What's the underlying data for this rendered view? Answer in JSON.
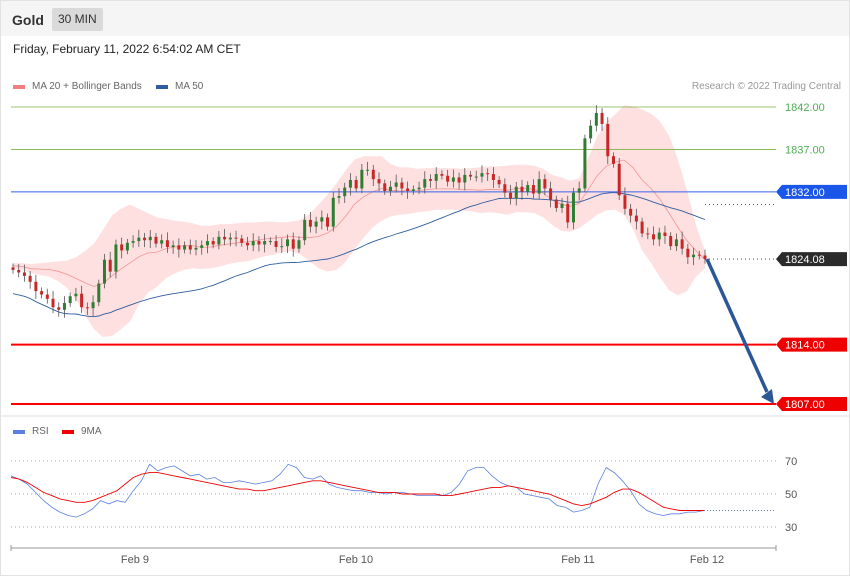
{
  "header": {
    "symbol": "Gold",
    "timeframe": "30 MIN"
  },
  "timestamp": "Friday, February 11, 2022 6:54:02 AM CET",
  "legend": {
    "ma20": {
      "label": "MA 20 + Bollinger Bands",
      "color": "#f08080"
    },
    "ma50": {
      "label": "MA 50",
      "color": "#2f5da0"
    },
    "rsi": {
      "label": "RSI",
      "color": "#5b7fe0"
    },
    "rsi_ma": {
      "label": "9MA",
      "color": "#ee0000"
    }
  },
  "credit": "Research © 2022 Trading Central",
  "colors": {
    "up": "#2e7d32",
    "down": "#c62828",
    "band": "#ffd6d6",
    "blue_line": "#3563e8",
    "red_line": "#ff0000",
    "green_line": "#7cb342",
    "arrow": "#2b5797"
  },
  "chart_data": [
    {
      "type": "candlestick",
      "ylim": [
        1801,
        1845
      ],
      "x_ticks": [
        "Feb 9",
        "Feb 10",
        "Feb 11",
        "Feb 12"
      ],
      "levels": [
        {
          "label": "1842.00",
          "value": 1842.0,
          "kind": "target"
        },
        {
          "label": "1837.00",
          "value": 1837.0,
          "kind": "target"
        },
        {
          "label": "1832.00",
          "value": 1832.0,
          "kind": "pivot"
        },
        {
          "label": "1824.08",
          "value": 1824.08,
          "kind": "last"
        },
        {
          "label": "1814.00",
          "value": 1814.0,
          "kind": "support"
        },
        {
          "label": "1807.00",
          "value": 1807.0,
          "kind": "support"
        }
      ],
      "close": [
        1822.8,
        1822.5,
        1822.1,
        1821.4,
        1820.3,
        1819.9,
        1819.4,
        1818.4,
        1818.1,
        1818.9,
        1819.7,
        1820.0,
        1818.4,
        1818.3,
        1819.0,
        1821.2,
        1824.0,
        1822.6,
        1825.8,
        1825.1,
        1826.0,
        1826.2,
        1826.6,
        1826.3,
        1826.7,
        1825.9,
        1826.3,
        1825.5,
        1825.7,
        1825.2,
        1825.7,
        1825.2,
        1825.4,
        1825.7,
        1826.2,
        1825.8,
        1826.7,
        1826.4,
        1826.6,
        1826.5,
        1826.0,
        1825.7,
        1826.2,
        1825.8,
        1826.2,
        1826.2,
        1825.5,
        1825.6,
        1826.4,
        1825.3,
        1826.3,
        1828.7,
        1827.9,
        1828.5,
        1829.0,
        1827.9,
        1831.3,
        1831.5,
        1832.5,
        1833.4,
        1832.4,
        1834.6,
        1834.6,
        1833.5,
        1833.0,
        1832.1,
        1832.6,
        1833.1,
        1832.4,
        1832.1,
        1832.3,
        1832.5,
        1833.5,
        1833.3,
        1834.1,
        1833.9,
        1833.2,
        1833.7,
        1833.1,
        1834.0,
        1833.8,
        1833.8,
        1834.2,
        1834.1,
        1833.4,
        1832.9,
        1831.9,
        1831.2,
        1832.6,
        1832.0,
        1832.8,
        1831.8,
        1833.5,
        1832.4,
        1831.1,
        1830.1,
        1830.6,
        1828.4,
        1831.9,
        1832.4,
        1838.3,
        1839.8,
        1841.3,
        1840.0,
        1836.2,
        1835.3,
        1831.6,
        1830.0,
        1829.2,
        1828.5,
        1827.1,
        1827.0,
        1826.4,
        1827.2,
        1826.8,
        1825.6,
        1826.4,
        1825.3,
        1824.3,
        1824.6,
        1824.5,
        1824.1
      ],
      "bollinger_upper": [
        1823.6,
        1823.6,
        1823.5,
        1823.6,
        1823.7,
        1823.8,
        1823.9,
        1824.3,
        1825.0,
        1825.9,
        1827.5,
        1829.2,
        1830.0,
        1830.5,
        1830.0,
        1829.5,
        1829.0,
        1828.8,
        1828.6,
        1828.5,
        1828.3,
        1828.0,
        1828.0,
        1828.2,
        1828.2,
        1828.3,
        1828.4,
        1828.4,
        1828.5,
        1828.5,
        1828.4,
        1828.5,
        1828.7,
        1829.4,
        1830.5,
        1831.7,
        1833.0,
        1834.5,
        1835.8,
        1836.2,
        1836.2,
        1836.2,
        1835.3,
        1834.9,
        1834.9,
        1834.7,
        1834.8,
        1834.8,
        1834.8,
        1834.8,
        1834.7,
        1834.8,
        1834.9,
        1835.0,
        1835.0,
        1835.1,
        1835.2,
        1835.2,
        1835.1,
        1834.7,
        1834.0,
        1833.7,
        1833.3,
        1833.6,
        1836.0,
        1838.5,
        1840.2,
        1841.1,
        1842.2,
        1842.1,
        1841.7,
        1841.2,
        1840.3,
        1838.6,
        1835.8,
        1832.2,
        1828.1,
        1825.0
      ],
      "bollinger_lower": [
        1823.0,
        1822.8,
        1822.4,
        1822.2,
        1822.0,
        1821.5,
        1820.7,
        1819.3,
        1817.6,
        1815.8,
        1814.9,
        1815.0,
        1815.8,
        1816.7,
        1818.7,
        1820.1,
        1820.8,
        1821.8,
        1822.4,
        1822.8,
        1823.0,
        1822.9,
        1823.0,
        1823.2,
        1823.5,
        1823.7,
        1823.8,
        1824.1,
        1824.4,
        1824.6,
        1824.9,
        1825.0,
        1824.6,
        1823.8,
        1823.0,
        1822.6,
        1822.8,
        1823.7,
        1825.3,
        1826.6,
        1827.8,
        1828.6,
        1829.1,
        1829.3,
        1829.4,
        1829.6,
        1829.7,
        1829.9,
        1829.9,
        1829.9,
        1829.8,
        1829.7,
        1829.5,
        1829.6,
        1829.5,
        1829.3,
        1829.6,
        1829.6,
        1829.5,
        1829.0,
        1828.1,
        1827.4,
        1827.3,
        1827.7,
        1828.5,
        1829.3,
        1829.8,
        1829.9,
        1829.3,
        1827.6,
        1825.1,
        1823.6,
        1821.9,
        1820.4,
        1819.8,
        1820.3,
        1822.0,
        1823.0
      ]
    },
    {
      "type": "line",
      "name_labels": [
        "RSI",
        "9MA"
      ],
      "y_ticks": [
        70,
        50,
        30
      ],
      "ylim": [
        20,
        80
      ],
      "rsi": [
        61,
        59,
        56,
        51,
        46,
        42,
        39,
        37,
        36,
        38,
        41,
        46,
        44,
        46,
        45,
        52,
        58,
        68,
        64,
        66,
        67,
        64,
        61,
        62,
        59,
        60,
        57,
        57,
        58,
        57,
        56,
        57,
        58,
        62,
        68,
        66,
        60,
        59,
        61,
        56,
        54,
        53,
        52,
        52,
        51,
        51,
        50,
        51,
        51,
        50,
        49,
        49,
        49,
        49,
        51,
        56,
        64,
        66,
        66,
        61,
        57,
        55,
        54,
        50,
        49,
        48,
        47,
        43,
        42,
        39,
        40,
        42,
        56,
        66,
        63,
        58,
        52,
        44,
        40,
        38,
        37,
        38,
        38,
        39,
        39,
        40
      ],
      "rsi_ma": [
        60,
        59,
        57,
        54,
        51,
        49,
        47,
        46,
        45,
        45,
        46,
        48,
        50,
        52,
        56,
        60,
        62,
        63,
        63,
        62,
        61,
        60,
        59,
        58,
        57,
        56,
        55,
        54,
        53,
        53,
        52,
        52,
        53,
        54,
        55,
        56,
        57,
        58,
        58,
        57,
        56,
        55,
        54,
        53,
        52,
        51,
        51,
        51,
        50,
        50,
        50,
        50,
        50,
        49,
        49,
        50,
        51,
        52,
        53,
        54,
        54,
        55,
        54,
        53,
        52,
        51,
        50,
        48,
        46,
        44,
        43,
        44,
        46,
        48,
        51,
        53,
        53,
        51,
        48,
        45,
        42,
        41,
        40,
        40,
        40,
        40
      ]
    }
  ]
}
